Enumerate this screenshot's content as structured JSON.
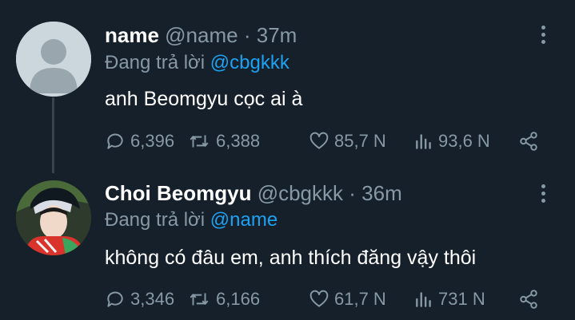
{
  "tweets": [
    {
      "display_name": "name",
      "handle": "@name",
      "separator": "·",
      "time": "37m",
      "replying_prefix": "Đang trả lời",
      "replying_to": "@cbgkkk",
      "text": "anh Beomgyu cọc ai à",
      "replies": "6,396",
      "retweets": "6,388",
      "likes": "85,7 N",
      "views": "93,6 N"
    },
    {
      "display_name": "Choi Beomgyu",
      "handle": "@cbgkkk",
      "separator": "·",
      "time": "36m",
      "replying_prefix": "Đang trả lời",
      "replying_to": "@name",
      "text": "không có đâu em, anh thích đăng vậy thôi",
      "replies": "3,346",
      "retweets": "6,166",
      "likes": "61,7 N",
      "views": "731 N"
    }
  ],
  "colors": {
    "background": "#15202b",
    "secondary_text": "#8899a6",
    "link": "#1da1f2"
  }
}
